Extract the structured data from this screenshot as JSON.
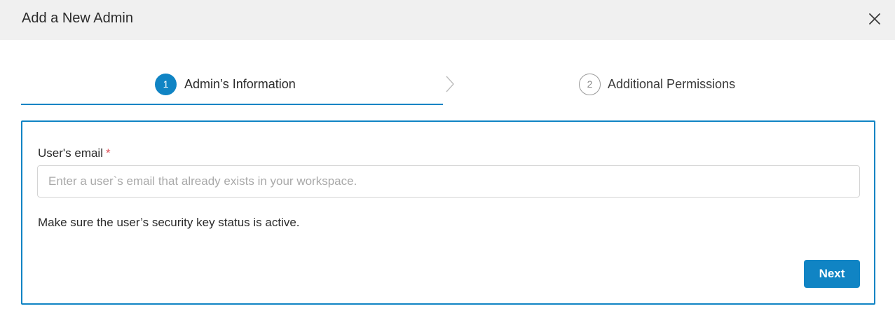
{
  "dialog": {
    "title": "Add a New Admin",
    "close_icon": "close-icon"
  },
  "stepper": {
    "steps": [
      {
        "number": "1",
        "label": "Admin’s Information",
        "state": "active"
      },
      {
        "number": "2",
        "label": "Additional Permissions",
        "state": "inactive"
      }
    ],
    "divider_icon": "chevron-right-icon"
  },
  "form": {
    "email_label": "User's email",
    "required_mark": "*",
    "email_value": "",
    "email_placeholder": "Enter a user`s email that already exists in your workspace.",
    "helper_text": "Make sure the user’s security key status is active.",
    "next_label": "Next"
  },
  "colors": {
    "accent": "#1084c4",
    "header_bg": "#f0f0f0",
    "required": "#e0515a",
    "inactive_step": "#9a9a9a"
  }
}
